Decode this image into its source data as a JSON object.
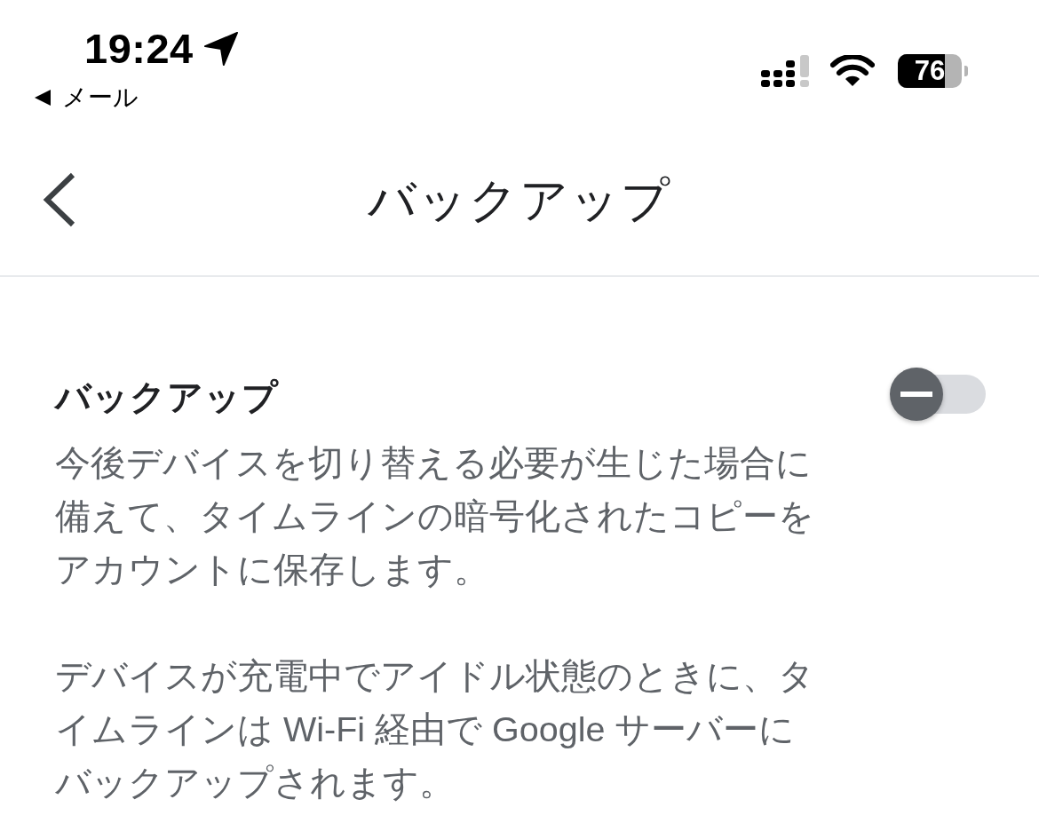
{
  "status_bar": {
    "time": "19:24",
    "back_app": "メール",
    "battery": "76"
  },
  "nav": {
    "title": "バックアップ"
  },
  "setting": {
    "title": "バックアップ",
    "on": false,
    "paragraphs": [
      "今後デバイスを切り替える必要が生じた場合に備えて、タイムラインの暗号化されたコピーをアカウントに保存します。",
      "デバイスが充電中でアイドル状態のときに、タイムラインは Wi-Fi 経由で Google サーバーにバックアップされます。"
    ]
  }
}
